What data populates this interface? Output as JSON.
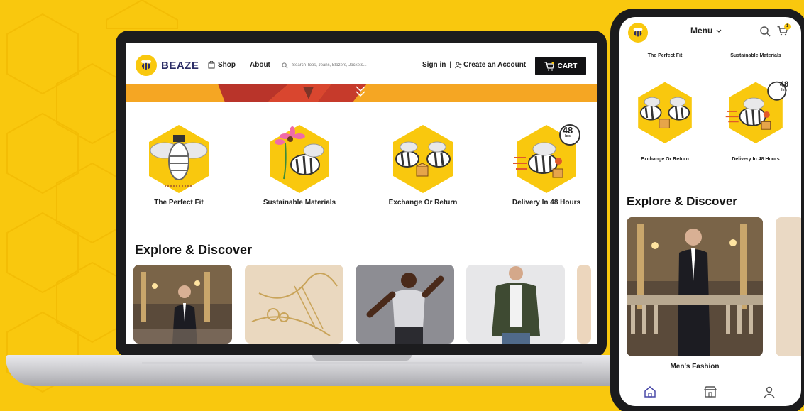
{
  "brand": {
    "name": "BEAZE"
  },
  "nav": {
    "shop": "Shop",
    "about": "About",
    "search_placeholder": "Search Tops, Jeans, Blazers, Jackets...",
    "sign_in": "Sign in",
    "separator": "|",
    "create_account": "Create an Account",
    "cart": "CART"
  },
  "features": [
    {
      "label": "The Perfect Fit"
    },
    {
      "label": "Sustainable Materials"
    },
    {
      "label": "Exchange Or Return"
    },
    {
      "label": "Delivery In 48 Hours",
      "badge_number": "48",
      "badge_unit": "hrs"
    }
  ],
  "explore": {
    "title": "Explore & Discover"
  },
  "phone": {
    "menu": "Menu",
    "cart_count": "1",
    "top_labels": [
      "The Perfect Fit",
      "Sustainable Materials"
    ],
    "feature_labels": [
      "Exchange Or Return",
      "Delivery In 48 Hours"
    ],
    "badge_number": "48",
    "badge_unit": "hrs",
    "explore_title": "Explore & Discover",
    "tile_label": "Men's Fashion"
  },
  "colors": {
    "background": "#f9c80e",
    "brand_navy": "#2b2d66",
    "banner_orange": "#f5a623",
    "cart_black": "#121214",
    "bottom_nav_accent": "#4a4aa8"
  }
}
